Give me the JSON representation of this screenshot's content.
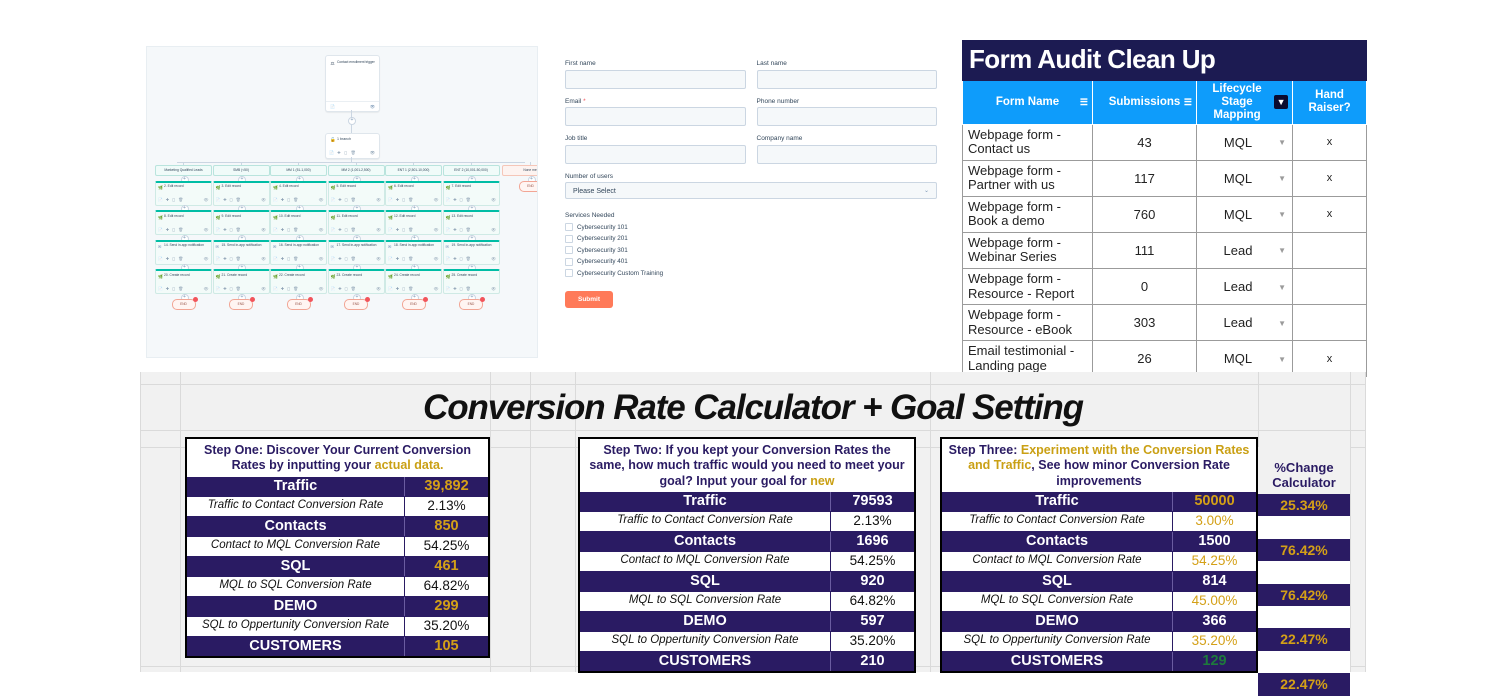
{
  "workflow": {
    "trigger": {
      "label": "Contact enrollment trigger",
      "icon": "filter-icon"
    },
    "branch": {
      "label": "1 branch",
      "icon": "branch-icon"
    },
    "branches": [
      {
        "chip": "Marketing Qualified Leads",
        "nodes": [
          {
            "n": "2. Edit record",
            "icon": "edit-icon"
          },
          {
            "n": "8. Edit record",
            "icon": "edit-icon"
          },
          {
            "n": "14. Send in-app notification",
            "icon": "mail-icon"
          },
          {
            "n": "20. Create record",
            "icon": "create-icon"
          }
        ],
        "end": "END"
      },
      {
        "chip": "SMB (<50)",
        "nodes": [
          {
            "n": "3. Edit record",
            "icon": "edit-icon"
          },
          {
            "n": "9. Edit record",
            "icon": "edit-icon"
          },
          {
            "n": "15. Send in-app notification",
            "icon": "mail-icon"
          },
          {
            "n": "21. Create record",
            "icon": "create-icon"
          }
        ],
        "end": "END"
      },
      {
        "chip": "MM 1 (51-1,000)",
        "nodes": [
          {
            "n": "4. Edit record",
            "icon": "edit-icon"
          },
          {
            "n": "10. Edit record",
            "icon": "edit-icon"
          },
          {
            "n": "16. Send in-app notification",
            "icon": "mail-icon"
          },
          {
            "n": "22. Create record",
            "icon": "create-icon"
          }
        ],
        "end": "END"
      },
      {
        "chip": "MM 2 (1,001-2,500)",
        "nodes": [
          {
            "n": "5. Edit record",
            "icon": "edit-icon"
          },
          {
            "n": "11. Edit record",
            "icon": "edit-icon"
          },
          {
            "n": "17. Send in-app notification",
            "icon": "mail-icon"
          },
          {
            "n": "23. Create record",
            "icon": "create-icon"
          }
        ],
        "end": "END"
      },
      {
        "chip": "ENT 1 (2,501-10,000)",
        "nodes": [
          {
            "n": "6. Edit record",
            "icon": "edit-icon"
          },
          {
            "n": "12. Edit record",
            "icon": "edit-icon"
          },
          {
            "n": "18. Send in-app notification",
            "icon": "mail-icon"
          },
          {
            "n": "24. Create record",
            "icon": "create-icon"
          }
        ],
        "end": "END"
      },
      {
        "chip": "ENT 2 (10,001-50,000)",
        "nodes": [
          {
            "n": "7. Edit record",
            "icon": "edit-icon"
          },
          {
            "n": "13. Edit record",
            "icon": "edit-icon"
          },
          {
            "n": "19. Send in-app notification",
            "icon": "mail-icon"
          },
          {
            "n": "25. Create record",
            "icon": "create-icon"
          }
        ],
        "end": "END"
      }
    ],
    "none_branch": {
      "chip": "None met",
      "end": "END"
    }
  },
  "form": {
    "fields": [
      {
        "label": "First name",
        "value": "",
        "required": false
      },
      {
        "label": "Last name",
        "value": "",
        "required": false
      },
      {
        "label": "Email",
        "value": "",
        "required": true
      },
      {
        "label": "Phone number",
        "value": "",
        "required": false
      },
      {
        "label": "Job title",
        "value": "",
        "required": false
      },
      {
        "label": "Company name",
        "value": "",
        "required": false
      }
    ],
    "select": {
      "label": "Number of users",
      "value": "Please Select"
    },
    "services_label": "Services Needed",
    "services": [
      "Cybersecurity 101",
      "Cybersecurity 201",
      "Cybersecurity 301",
      "Cybersecurity 401",
      "Cybersecurity Custom Training"
    ],
    "submit_label": "Submit",
    "accent": "#ff7a59"
  },
  "audit": {
    "title": "Form Audit Clean Up",
    "columns": [
      "Form Name",
      "Submissions",
      "Lifecycle Stage Mapping",
      "Hand Raiser?"
    ],
    "header_bg": "#0e9cfb",
    "title_bg": "#1c1b52",
    "rows": [
      {
        "name": "Webpage form - Contact us",
        "submissions": "43",
        "stage": "MQL",
        "hand": "x"
      },
      {
        "name": "Webpage form - Partner with us",
        "submissions": "117",
        "stage": "MQL",
        "hand": "x"
      },
      {
        "name": "Webpage form - Book a demo",
        "submissions": "760",
        "stage": "MQL",
        "hand": "x"
      },
      {
        "name": "Webpage form - Webinar Series",
        "submissions": "111",
        "stage": "Lead",
        "hand": ""
      },
      {
        "name": "Webpage form - Resource - Report",
        "submissions": "0",
        "stage": "Lead",
        "hand": ""
      },
      {
        "name": "Webpage form - Resource - eBook",
        "submissions": "303",
        "stage": "Lead",
        "hand": ""
      },
      {
        "name": "Email testimonial - Landing page",
        "submissions": "26",
        "stage": "MQL",
        "hand": "x"
      }
    ]
  },
  "calculator": {
    "title": "Conversion Rate Calculator + Goal Setting",
    "dark": "#2a1b63",
    "gold": "#d4a017",
    "green": "#1e7a3c",
    "steps": [
      {
        "heading_plain_1": "Step One: Discover Your Current Conversion Rates by inputting your ",
        "heading_gold": "actual data.",
        "heading_plain_2": "",
        "rows": [
          {
            "type": "dark",
            "label": "Traffic",
            "value": "39,892",
            "value_color": "gold"
          },
          {
            "type": "light",
            "label": "Traffic to Contact Conversion Rate",
            "value": "2.13%",
            "value_color": "black"
          },
          {
            "type": "dark",
            "label": "Contacts",
            "value": "850",
            "value_color": "gold"
          },
          {
            "type": "light",
            "label": "Contact to MQL Conversion Rate",
            "value": "54.25%",
            "value_color": "black"
          },
          {
            "type": "dark",
            "label": "SQL",
            "value": "461",
            "value_color": "gold"
          },
          {
            "type": "light",
            "label": "MQL to SQL Conversion Rate",
            "value": "64.82%",
            "value_color": "black"
          },
          {
            "type": "dark",
            "label": "DEMO",
            "value": "299",
            "value_color": "gold"
          },
          {
            "type": "light",
            "label": "SQL to Oppertunity Conversion Rate",
            "value": "35.20%",
            "value_color": "black"
          },
          {
            "type": "dark",
            "label": "CUSTOMERS",
            "value": "105",
            "value_color": "gold"
          }
        ]
      },
      {
        "heading_plain_1": "Step Two: If you kept your Conversion Rates the same, how much traffic would you need to meet your goal? Input your goal for ",
        "heading_gold": "new",
        "heading_plain_2": "",
        "rows": [
          {
            "type": "dark",
            "label": "Traffic",
            "value": "79593",
            "value_color": "white"
          },
          {
            "type": "light",
            "label": "Traffic to Contact Conversion Rate",
            "value": "2.13%",
            "value_color": "black"
          },
          {
            "type": "dark",
            "label": "Contacts",
            "value": "1696",
            "value_color": "white"
          },
          {
            "type": "light",
            "label": "Contact to MQL Conversion Rate",
            "value": "54.25%",
            "value_color": "black"
          },
          {
            "type": "dark",
            "label": "SQL",
            "value": "920",
            "value_color": "white"
          },
          {
            "type": "light",
            "label": "MQL to SQL Conversion Rate",
            "value": "64.82%",
            "value_color": "black"
          },
          {
            "type": "dark",
            "label": "DEMO",
            "value": "597",
            "value_color": "white"
          },
          {
            "type": "light",
            "label": "SQL to Oppertunity Conversion Rate",
            "value": "35.20%",
            "value_color": "black"
          },
          {
            "type": "dark",
            "label": "CUSTOMERS",
            "value": "210",
            "value_color": "white"
          }
        ]
      },
      {
        "heading_plain_1": "Step Three: ",
        "heading_gold": "Experiment with the Conversion Rates and Traffic",
        "heading_plain_2": ", See how minor Conversion Rate improvements",
        "rows": [
          {
            "type": "dark",
            "label": "Traffic",
            "value": "50000",
            "value_color": "gold"
          },
          {
            "type": "light",
            "label": "Traffic to Contact Conversion Rate",
            "value": "3.00%",
            "value_color": "gold"
          },
          {
            "type": "dark",
            "label": "Contacts",
            "value": "1500",
            "value_color": "white"
          },
          {
            "type": "light",
            "label": "Contact to MQL Conversion Rate",
            "value": "54.25%",
            "value_color": "gold"
          },
          {
            "type": "dark",
            "label": "SQL",
            "value": "814",
            "value_color": "white"
          },
          {
            "type": "light",
            "label": "MQL to SQL Conversion Rate",
            "value": "45.00%",
            "value_color": "gold"
          },
          {
            "type": "dark",
            "label": "DEMO",
            "value": "366",
            "value_color": "white"
          },
          {
            "type": "light",
            "label": "SQL to Oppertunity Conversion Rate",
            "value": "35.20%",
            "value_color": "gold"
          },
          {
            "type": "dark",
            "label": "CUSTOMERS",
            "value": "129",
            "value_color": "green"
          }
        ]
      }
    ],
    "pct": {
      "header": "%Change Calculator",
      "cells": [
        {
          "type": "dark",
          "value": "25.34%"
        },
        {
          "type": "light",
          "value": ""
        },
        {
          "type": "dark",
          "value": "76.42%"
        },
        {
          "type": "light",
          "value": ""
        },
        {
          "type": "dark",
          "value": "76.42%"
        },
        {
          "type": "light",
          "value": ""
        },
        {
          "type": "dark",
          "value": "22.47%"
        },
        {
          "type": "light",
          "value": ""
        },
        {
          "type": "dark",
          "value": "22.47%"
        }
      ]
    }
  }
}
